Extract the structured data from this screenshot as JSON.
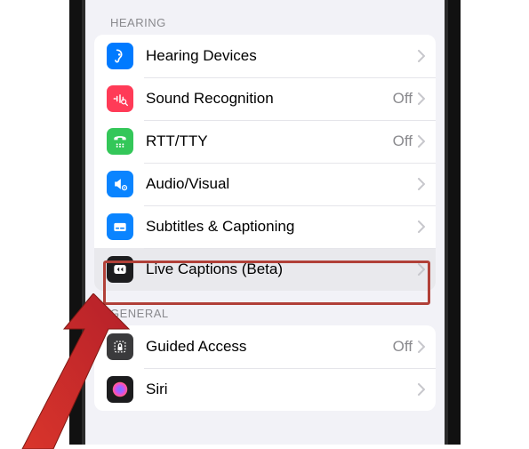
{
  "sections": {
    "hearing": {
      "header": "HEARING",
      "items": [
        {
          "id": "hearing-devices",
          "label": "Hearing Devices",
          "status": "",
          "icon_bg": "#007aff",
          "icon": "ear"
        },
        {
          "id": "sound-recognition",
          "label": "Sound Recognition",
          "status": "Off",
          "icon_bg": "#ff3b57",
          "icon": "wave-search"
        },
        {
          "id": "rtt-tty",
          "label": "RTT/TTY",
          "status": "Off",
          "icon_bg": "#34c759",
          "icon": "phone-old"
        },
        {
          "id": "audio-visual",
          "label": "Audio/Visual",
          "status": "",
          "icon_bg": "#0a84ff",
          "icon": "speaker-eye"
        },
        {
          "id": "subtitles-captioning",
          "label": "Subtitles & Captioning",
          "status": "",
          "icon_bg": "#0a84ff",
          "icon": "caption-box"
        },
        {
          "id": "live-captions",
          "label": "Live Captions (Beta)",
          "status": "",
          "icon_bg": "#1c1c1e",
          "icon": "live-caption",
          "highlighted": true
        }
      ]
    },
    "general": {
      "header": "GENERAL",
      "items": [
        {
          "id": "guided-access",
          "label": "Guided Access",
          "status": "Off",
          "icon_bg": "#3a3a3c",
          "icon": "lock-frame"
        },
        {
          "id": "siri",
          "label": "Siri",
          "status": "",
          "icon_bg": "#1c1c1e",
          "icon": "siri-orb"
        }
      ]
    }
  },
  "annotation": {
    "highlight_target": "live-captions",
    "highlight_color": "#b14038",
    "arrow_color_start": "#d9352b",
    "arrow_color_end": "#b5202a"
  }
}
